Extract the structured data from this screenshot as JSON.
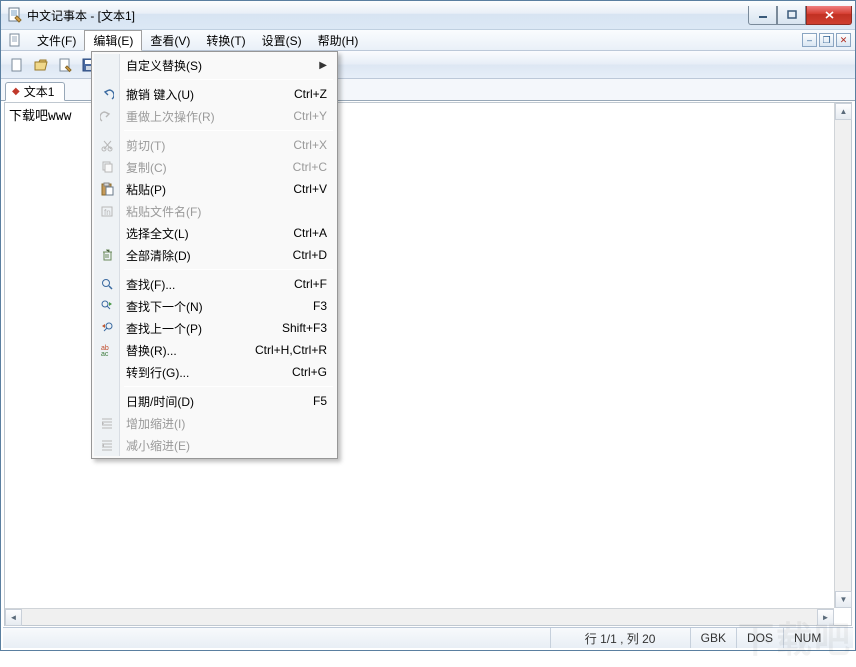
{
  "title": "中文记事本 - [文本1]",
  "menus": {
    "file": "文件(F)",
    "edit": "编辑(E)",
    "view": "查看(V)",
    "convert": "转换(T)",
    "settings": "设置(S)",
    "help": "帮助(H)"
  },
  "tab": {
    "label": "文本1"
  },
  "editor_text": "下载吧www",
  "dropdown": {
    "custom_replace": "自定义替换(S)",
    "undo": {
      "label": "撤销 键入(U)",
      "shortcut": "Ctrl+Z"
    },
    "redo": {
      "label": "重做上次操作(R)",
      "shortcut": "Ctrl+Y"
    },
    "cut": {
      "label": "剪切(T)",
      "shortcut": "Ctrl+X"
    },
    "copy": {
      "label": "复制(C)",
      "shortcut": "Ctrl+C"
    },
    "paste": {
      "label": "粘贴(P)",
      "shortcut": "Ctrl+V"
    },
    "paste_filename": {
      "label": "粘贴文件名(F)",
      "shortcut": ""
    },
    "select_all": {
      "label": "选择全文(L)",
      "shortcut": "Ctrl+A"
    },
    "clear_all": {
      "label": "全部清除(D)",
      "shortcut": "Ctrl+D"
    },
    "find": {
      "label": "查找(F)...",
      "shortcut": "Ctrl+F"
    },
    "find_next": {
      "label": "查找下一个(N)",
      "shortcut": "F3"
    },
    "find_prev": {
      "label": "查找上一个(P)",
      "shortcut": "Shift+F3"
    },
    "replace": {
      "label": "替换(R)...",
      "shortcut": "Ctrl+H,Ctrl+R"
    },
    "goto": {
      "label": "转到行(G)...",
      "shortcut": "Ctrl+G"
    },
    "datetime": {
      "label": "日期/时间(D)",
      "shortcut": "F5"
    },
    "indent": {
      "label": "增加缩进(I)",
      "shortcut": ""
    },
    "outdent": {
      "label": "减小缩进(E)",
      "shortcut": ""
    }
  },
  "status": {
    "pos": "行 1/1 , 列 20",
    "enc": "GBK",
    "eol": "DOS",
    "num": "NUM"
  },
  "watermark": "下载吧"
}
